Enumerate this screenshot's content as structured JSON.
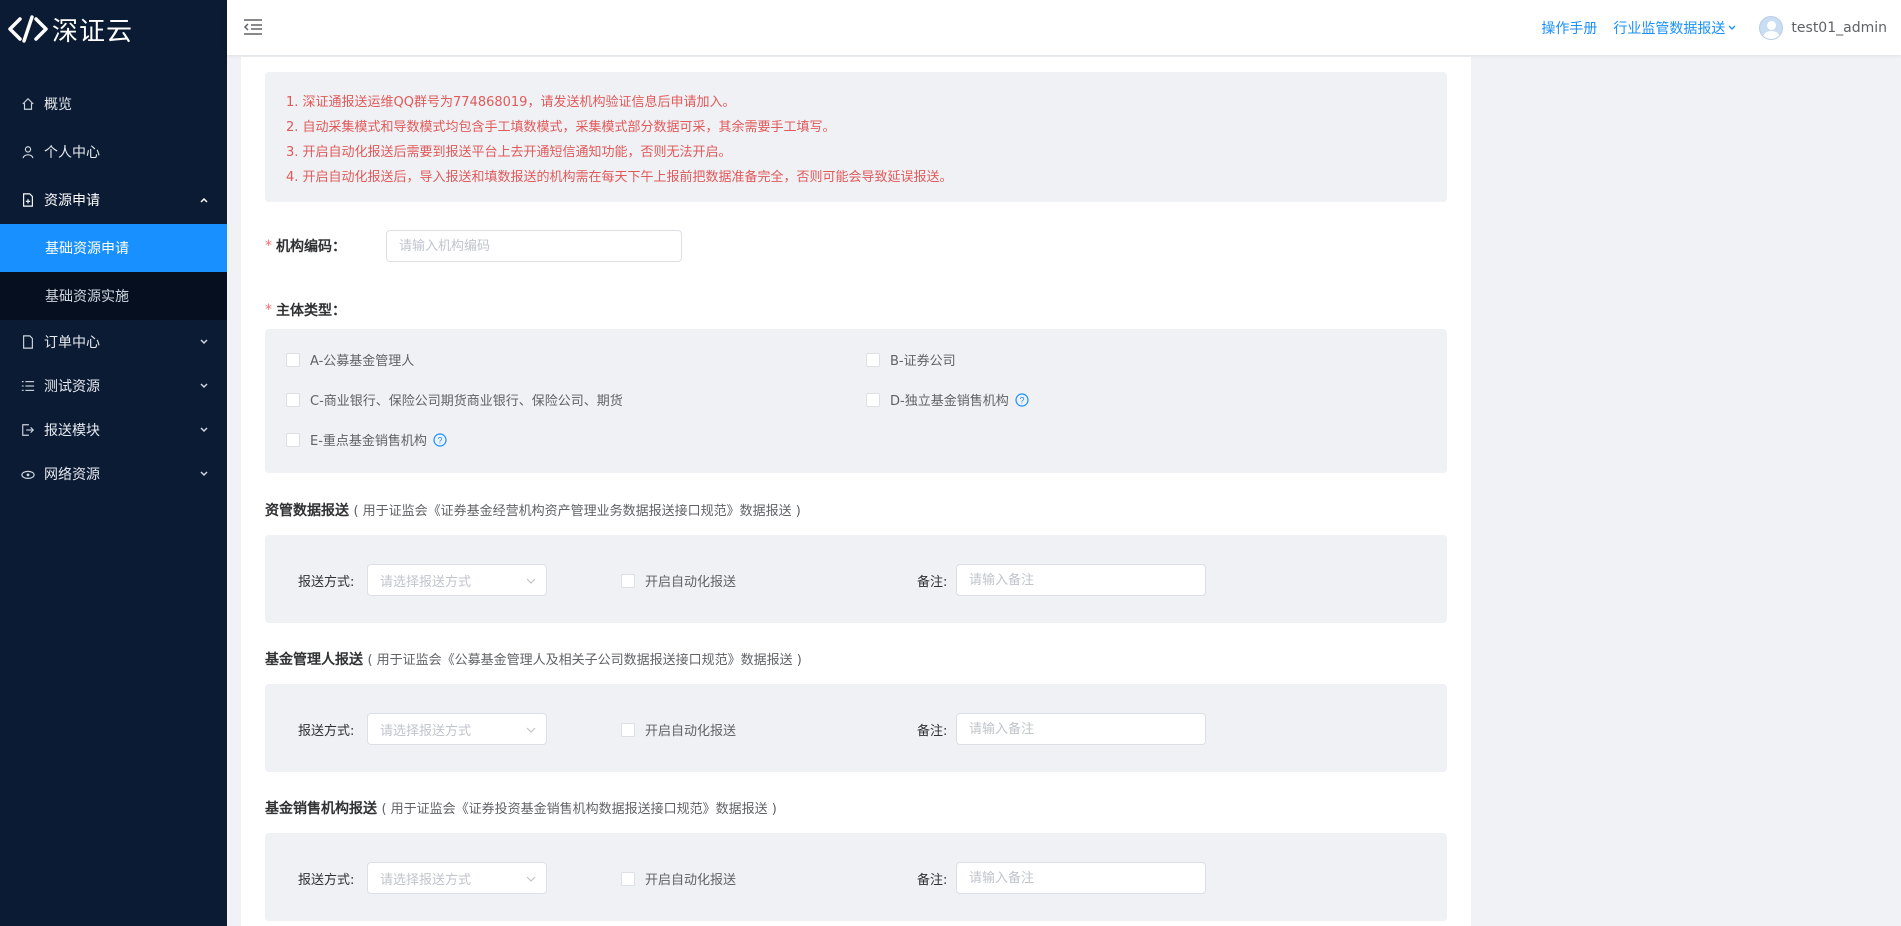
{
  "app": {
    "logo_text": "深证云"
  },
  "sidebar": {
    "items": [
      {
        "label": "概览",
        "icon": "home-icon"
      },
      {
        "label": "个人中心",
        "icon": "user-icon"
      },
      {
        "label": "资源申请",
        "icon": "document-icon",
        "open": true,
        "children": [
          {
            "label": "基础资源申请",
            "active": true
          },
          {
            "label": "基础资源实施"
          }
        ]
      },
      {
        "label": "订单中心",
        "icon": "file-icon"
      },
      {
        "label": "测试资源",
        "icon": "list-icon"
      },
      {
        "label": "报送模块",
        "icon": "export-icon"
      },
      {
        "label": "网络资源",
        "icon": "network-icon"
      }
    ]
  },
  "header": {
    "manual_link": "操作手册",
    "report_dropdown": "行业监管数据报送",
    "username": "test01_admin"
  },
  "notice": {
    "lines": [
      "1. 深证通报送运维QQ群号为774868019，请发送机构验证信息后申请加入。",
      "2. 自动采集模式和导数模式均包含手工填数模式，采集模式部分数据可采，其余需要手工填写。",
      "3. 开启自动化报送后需要到报送平台上去开通短信通知功能，否则无法开启。",
      "4. 开启自动化报送后，导入报送和填数报送的机构需在每天下午上报前把数据准备完全，否则可能会导致延误报送。"
    ]
  },
  "form": {
    "org_code_label": "机构编码：",
    "org_code_placeholder": "请输入机构编码",
    "entity_type_label": "主体类型：",
    "entity_types": [
      "A-公募基金管理人",
      "B-证券公司",
      "C-商业银行、保险公司期货商业银行、保险公司、期货",
      "D-独立基金销售机构",
      "E-重点基金销售机构"
    ]
  },
  "sections": [
    {
      "title": "资管数据报送",
      "desc": "( 用于证监会《证券基金经营机构资产管理业务数据报送接口规范》数据报送 )",
      "method_label": "报送方式:",
      "method_placeholder": "请选择报送方式",
      "auto_label": "开启自动化报送",
      "note_label": "备注:",
      "note_placeholder": "请输入备注"
    },
    {
      "title": "基金管理人报送",
      "desc": "( 用于证监会《公募基金管理人及相关子公司数据报送接口规范》数据报送 )",
      "method_label": "报送方式:",
      "method_placeholder": "请选择报送方式",
      "auto_label": "开启自动化报送",
      "note_label": "备注:",
      "note_placeholder": "请输入备注"
    },
    {
      "title": "基金销售机构报送",
      "desc": "( 用于证监会《证券投资基金销售机构数据报送接口规范》数据报送 )",
      "method_label": "报送方式:",
      "method_placeholder": "请选择报送方式",
      "auto_label": "开启自动化报送",
      "note_label": "备注:",
      "note_placeholder": "请输入备注"
    }
  ],
  "colors": {
    "sidebar_bg": "#0b1b33",
    "active_blue": "#1890ff",
    "notice_red": "#e05a5a",
    "panel_gray": "#f0f1f5"
  }
}
